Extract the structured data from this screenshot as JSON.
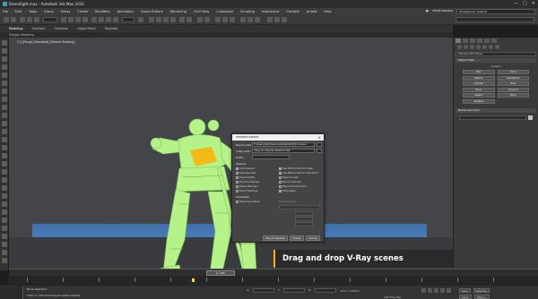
{
  "window": {
    "title": "DemoFight.max - Autodesk 3ds Max 2020",
    "controls": [
      "—",
      "□",
      "✕"
    ]
  },
  "menu": {
    "items": [
      "File",
      "Edit",
      "Tools",
      "Group",
      "Views",
      "Create",
      "Modifiers",
      "Animation",
      "Graph Editors",
      "Rendering",
      "Civil View",
      "Customize",
      "Scripting",
      "Interactive",
      "Content",
      "Arnold",
      "Help"
    ],
    "user": "vlrndropresso",
    "workspace": "Workspaces: Default"
  },
  "ribbon": {
    "tabs": [
      "Modeling",
      "Freeform",
      "Selection",
      "Object Paint",
      "Populate"
    ],
    "active": "Modeling",
    "sub": "Polygon Modeling"
  },
  "viewport": {
    "label": "[+] [Persp] [Standard] [Default Shading]"
  },
  "caption": {
    "text": "Drag and drop V-Ray scenes"
  },
  "dialog": {
    "title": "vrscene export",
    "export_path_label": "Export path:",
    "export_path_value": "C:\\Users\\User\\Downloads\\DemoFight.vrscene",
    "vray_path_label": "V-Ray path:",
    "vray_path_value": "V-Ray for 3dsmax 2020 for x64",
    "prefix_label": "Prefix:",
    "options_label": "Options",
    "animation_label": "Animation",
    "options": [
      {
        "label": "Compressed",
        "on": true
      },
      {
        "label": "Use HEX format for mesh",
        "on": true
      },
      {
        "label": "Separate files",
        "on": false
      },
      {
        "label": "Use HEX format for transform",
        "on": true
      },
      {
        "label": "Export lights",
        "on": false
      },
      {
        "label": "Export nodes",
        "on": false
      },
      {
        "label": "Export materials",
        "on": false
      },
      {
        "label": "Export textures",
        "on": false
      },
      {
        "label": "Export Bitmaps",
        "on": false
      },
      {
        "label": "Export Environment",
        "on": false
      },
      {
        "label": "Export Settings",
        "on": false
      },
      {
        "label": "Strip paths",
        "on": true
      }
    ],
    "export_animation": "Export animation",
    "export_range_label": "Export range",
    "buttons": [
      "Export selected",
      "Export",
      "Cancel"
    ]
  },
  "command_panel": {
    "dropdown": "Standard Primitives",
    "object_type": "Object Type",
    "autogrid": "AutoGrid",
    "objects": [
      "Box",
      "Cone",
      "Sphere",
      "GeoSphere",
      "Cylinder",
      "Tube",
      "Torus",
      "Pyramid",
      "Teapot",
      "Plane",
      "TextPlus"
    ],
    "name_and_color": "Name and Color"
  },
  "timeline": {
    "frame": "0 / 100"
  },
  "status": {
    "selection": "None Selected",
    "prompt": "Click or click-and-drag to select objects",
    "grid": "Grid = 0,254m",
    "add_time_tag": "Add Time Tag",
    "auto": "Auto",
    "selected": "Selected",
    "set_k": "Set K.",
    "filters": "Filters..."
  },
  "colors": {
    "robot": "#b6f28a",
    "highlight": "#ffb000",
    "floor": "#4e86c4"
  }
}
